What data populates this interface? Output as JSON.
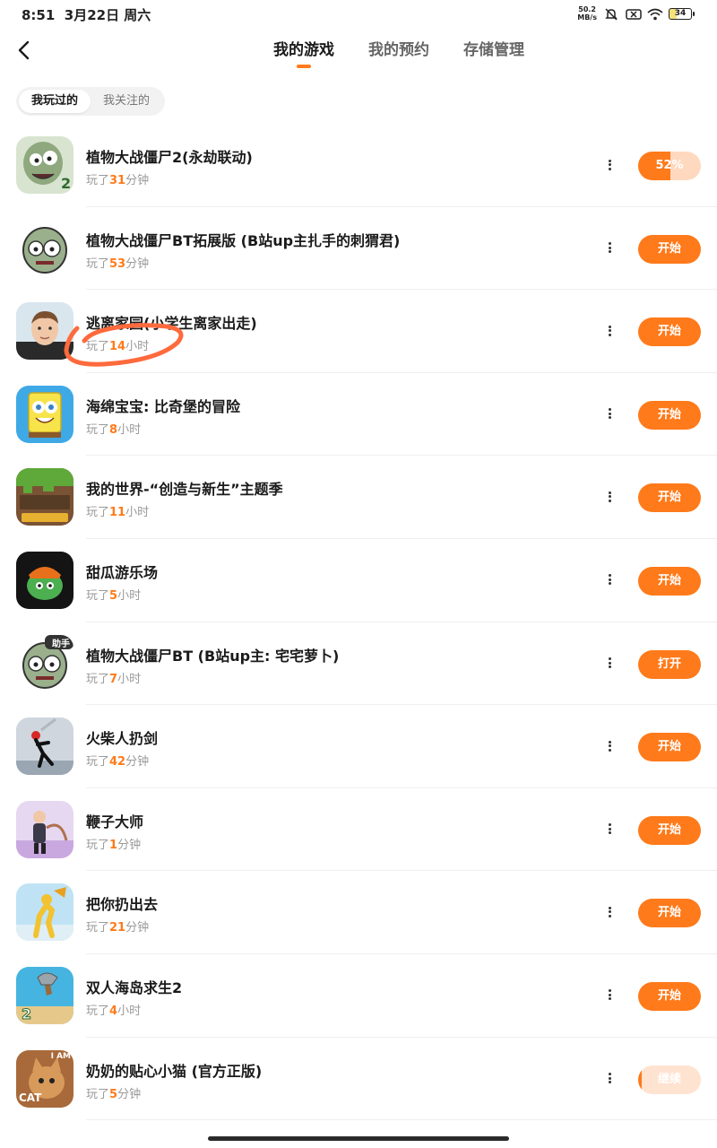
{
  "status_bar": {
    "time": "8:51",
    "date": "3月22日 周六",
    "net_speed_value": "50.2",
    "net_speed_unit": "MB/s",
    "battery": "34"
  },
  "header": {
    "tabs": [
      {
        "label": "我的游戏",
        "active": true
      },
      {
        "label": "我的预约",
        "active": false
      },
      {
        "label": "存储管理",
        "active": false
      }
    ]
  },
  "segment": {
    "items": [
      {
        "label": "我玩过的",
        "active": true
      },
      {
        "label": "我关注的",
        "active": false
      }
    ]
  },
  "games": [
    {
      "title": "植物大战僵尸2(永劫联动)",
      "played_prefix": "玩了",
      "played_num": "31",
      "played_unit": "分钟",
      "action": "52%",
      "progress": 0.52,
      "icon": "pvz2-zombie-icon"
    },
    {
      "title": "植物大战僵尸BT拓展版 (B站up主扎手的刺猬君)",
      "played_prefix": "玩了",
      "played_num": "53",
      "played_unit": "分钟",
      "action": "开始",
      "icon": "zombie-head-icon"
    },
    {
      "title": "逃离家园(小学生离家出走)",
      "played_prefix": "玩了",
      "played_num": "14",
      "played_unit": "小时",
      "action": "开始",
      "icon": "boy-face-icon"
    },
    {
      "title": "海绵宝宝: 比奇堡的冒险",
      "played_prefix": "玩了",
      "played_num": "8",
      "played_unit": "小时",
      "action": "开始",
      "icon": "spongebob-icon"
    },
    {
      "title": "我的世界-“创造与新生”主题季",
      "played_prefix": "玩了",
      "played_num": "11",
      "played_unit": "小时",
      "action": "开始",
      "icon": "minecraft-icon"
    },
    {
      "title": "甜瓜游乐场",
      "played_prefix": "玩了",
      "played_num": "5",
      "played_unit": "小时",
      "action": "开始",
      "icon": "melon-playground-icon"
    },
    {
      "title": "植物大战僵尸BT (B站up主: 宅宅萝卜)",
      "played_prefix": "玩了",
      "played_num": "7",
      "played_unit": "小时",
      "action": "打开",
      "icon": "zombie-head-helper-icon",
      "badge": "助手"
    },
    {
      "title": "火柴人扔剑",
      "played_prefix": "玩了",
      "played_num": "42",
      "played_unit": "分钟",
      "action": "开始",
      "icon": "stickman-sword-icon"
    },
    {
      "title": "鞭子大师",
      "played_prefix": "玩了",
      "played_num": "1",
      "played_unit": "分钟",
      "action": "开始",
      "icon": "whip-master-icon"
    },
    {
      "title": "把你扔出去",
      "played_prefix": "玩了",
      "played_num": "21",
      "played_unit": "分钟",
      "action": "开始",
      "icon": "throw-you-icon"
    },
    {
      "title": "双人海岛求生2",
      "played_prefix": "玩了",
      "played_num": "4",
      "played_unit": "小时",
      "action": "开始",
      "icon": "island-survival-icon"
    },
    {
      "title": "奶奶的贴心小猫 (官方正版)",
      "played_prefix": "玩了",
      "played_num": "5",
      "played_unit": "分钟",
      "action": "继续",
      "icon": "grandma-cat-icon",
      "badge_top": "I AM",
      "badge_bottom": "CAT"
    }
  ],
  "colors": {
    "accent": "#ff7a1a",
    "annotation": "#ff6a3d"
  }
}
